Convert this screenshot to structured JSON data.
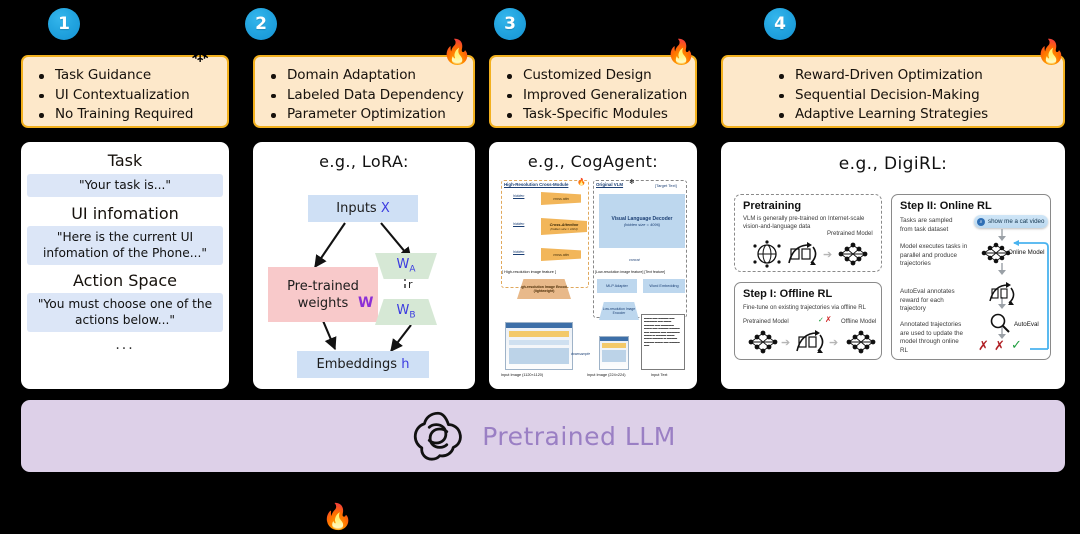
{
  "badges": [
    {
      "number": "1"
    },
    {
      "number": "2"
    },
    {
      "number": "3"
    },
    {
      "number": "4"
    }
  ],
  "headers": [
    {
      "id": "prompting",
      "marker": "snowflake",
      "marker_glyph": "❄",
      "bullets": [
        "Task Guidance",
        "UI Contextualization",
        "No Training Required"
      ]
    },
    {
      "id": "fine-tuning",
      "marker": "fire",
      "marker_glyph": "🔥",
      "bullets": [
        "Domain Adaptation",
        "Labeled Data Dependency",
        "Parameter Optimization"
      ]
    },
    {
      "id": "architecture",
      "marker": "fire",
      "marker_glyph": "🔥",
      "bullets": [
        "Customized Design",
        "Improved Generalization",
        "Task-Specific Modules"
      ]
    },
    {
      "id": "reinforcement-learning",
      "marker": "fire",
      "marker_glyph": "🔥",
      "bullets": [
        "Reward-Driven Optimization",
        "Sequential Decision-Making",
        "Adaptive Learning Strategies"
      ]
    }
  ],
  "prompt_panel": {
    "sections": [
      {
        "heading": "Task",
        "text": "\"Your task is...\""
      },
      {
        "heading": "UI infomation",
        "text": "\"Here is the current UI infomation of the Phone...\""
      },
      {
        "heading": "Action Space",
        "text": "\"You must choose one of the actions below...\""
      }
    ],
    "ellipsis": "..."
  },
  "lora_panel": {
    "title": "e.g., LoRA:",
    "inputs_label": "Inputs",
    "inputs_var": "X",
    "pretrained_label": "Pre-trained weights",
    "pretrained_var": "W",
    "adapter_a": "W",
    "adapter_a_sub": "A",
    "adapter_b": "W",
    "adapter_b_sub": "B",
    "rank_label": "r",
    "embeddings_label": "Embeddings",
    "embeddings_var": "h"
  },
  "cogagent_panel": {
    "title": "e.g.,  CogAgent:",
    "high_res_branch_title": "High-Resolution Cross-Module",
    "high_res_marker": "🔥",
    "llm_branch_title": "Original VLM",
    "llm_marker": "❄",
    "target_box_label": "[Target Text]",
    "decoder_title": "Visual Language Decoder",
    "decoder_sub": "(hidden size = 4096)",
    "cross_attention_title": "Cross-Attention",
    "cross_attention_sub": "(hidden size = 1024)",
    "cross_labels": [
      "cross attn",
      "cross attn",
      "cross attn"
    ],
    "hidden_labels": [
      "hidden",
      "hidden",
      "hidden"
    ],
    "feature_label_left": "[ High-resolution image feature ]",
    "feature_label_right": "[Low-resolution image feature] [Text feature]",
    "concat_label": "concat",
    "encoder_high": "High-resolution Image Encoder (lightweight)",
    "encoder_low": "Low-resolution Image Encoder",
    "mlp_adapter": "MLP Adapter",
    "word_embedding": "Word Embedding",
    "screenshot_label": "downsample",
    "captions": [
      "Input Image (1120×1120)",
      "Input Image (224×224)",
      "Input Text"
    ]
  },
  "digirl_panel": {
    "title": "e.g.,  DigiRL:",
    "pretraining": {
      "heading": "Pretraining",
      "body": "VLM is generally pre-trained on Internet-scale vision-and-language data",
      "model_label": "Pretrained Model"
    },
    "offline": {
      "heading": "Step I: Offline RL",
      "body": "Fine-tune on existing trajectories via offline RL",
      "left_label": "Pretrained Model",
      "right_label": "Offline Model",
      "check": "✓",
      "cross": "✗"
    },
    "online": {
      "heading": "Step II: Online RL",
      "steps": [
        "Tasks are sampled from task dataset",
        "Model executes tasks in parallel and produce trajectories",
        "AutoEval annotates reward for each trajectory",
        "Annotated trajectories are used to update the model through online RL"
      ],
      "chip_text": "show me a cat video",
      "online_model_label": "Online Model",
      "autoeval_label": "AutoEval",
      "marks": [
        "✗",
        "✗",
        "✓"
      ]
    }
  },
  "llm_bar": {
    "label": "Pretrained LLM",
    "logo": "openai-logo"
  },
  "legend": [
    {
      "id": "frozen",
      "glyph": "❄"
    },
    {
      "id": "trainable",
      "glyph": "🔥"
    }
  ],
  "colors": {
    "badge_blue": "#1da3e0",
    "header_fill": "#fde8ca",
    "header_border": "#f2b01e",
    "prompt_fill": "#dce6f7",
    "lora_blue": "#cfe0f5",
    "lora_pink": "#f8c9ca",
    "lora_green": "#d6e8d5",
    "llm_bar": "#ddd0e8",
    "llm_text": "#9a7fc4"
  }
}
